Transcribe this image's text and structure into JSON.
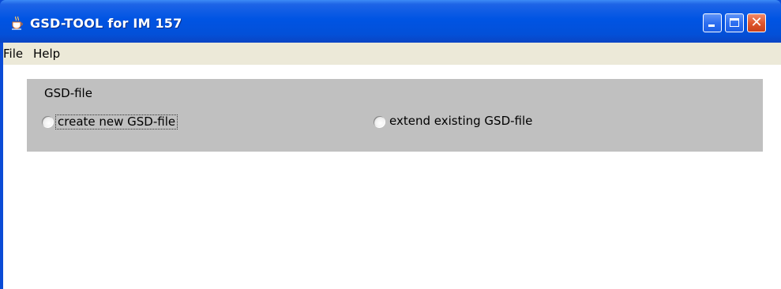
{
  "window": {
    "title": "GSD-TOOL for IM 157",
    "icon": "java-cup-icon",
    "controls": {
      "minimize": "minimize-icon",
      "maximize": "maximize-icon",
      "close": "close-icon",
      "close_glyph": "✕"
    },
    "accent_color": "#0054e3",
    "close_color": "#e0582f"
  },
  "menubar": {
    "items": [
      {
        "label": "File"
      },
      {
        "label": "Help"
      }
    ]
  },
  "gsd_panel": {
    "title": "GSD-file",
    "options": [
      {
        "label": "create new GSD-file",
        "selected": false,
        "focused": true
      },
      {
        "label": "extend existing GSD-file",
        "selected": false,
        "focused": false
      }
    ],
    "panel_color": "#c0c0c0"
  }
}
